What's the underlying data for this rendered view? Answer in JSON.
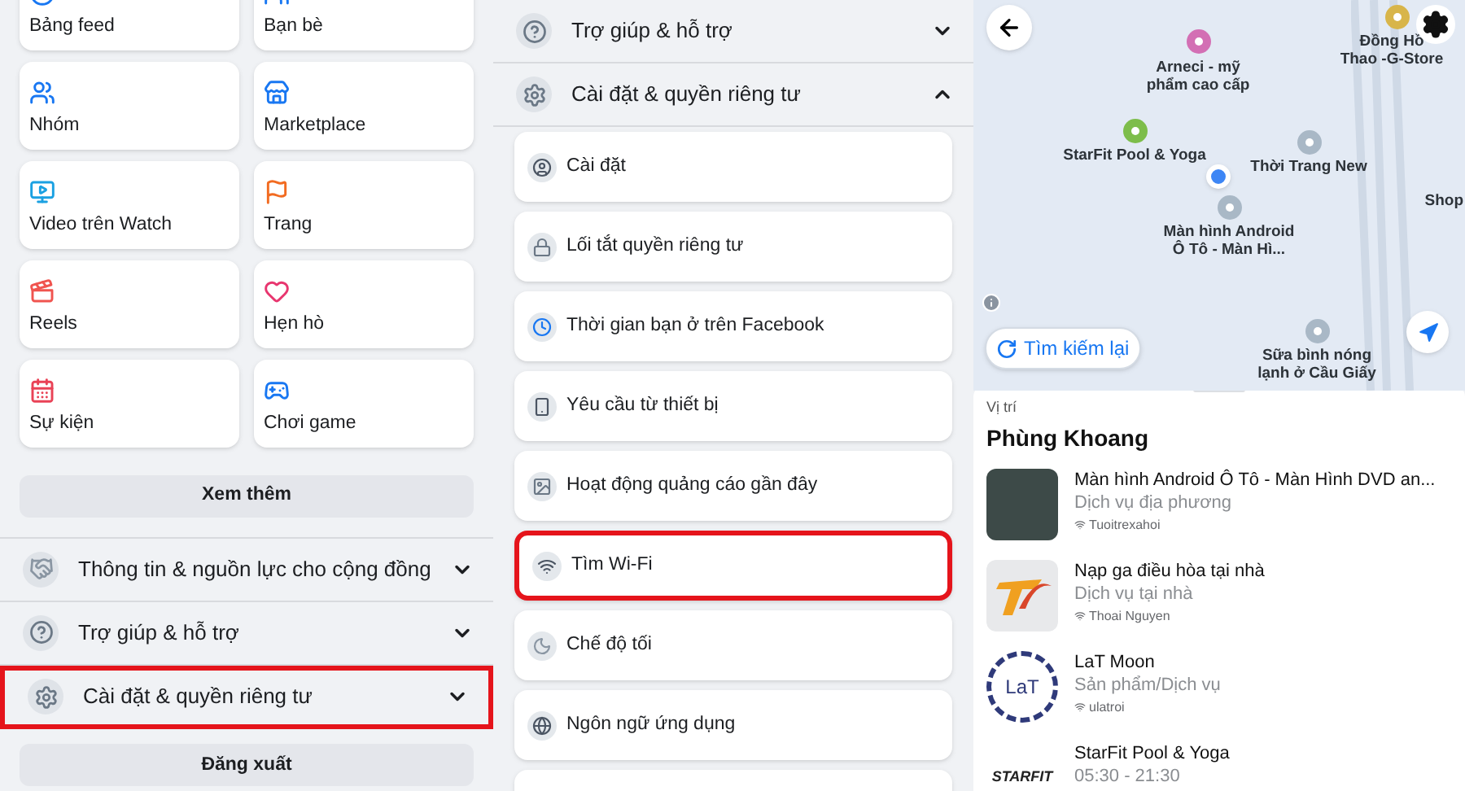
{
  "menu_panel": {
    "shortcuts": [
      {
        "label": "Bảng feed",
        "kind": "clock"
      },
      {
        "label": "Bạn bè",
        "kind": "friends"
      },
      {
        "label": "Nhóm",
        "kind": "groups"
      },
      {
        "label": "Marketplace",
        "kind": "store"
      },
      {
        "label": "Video trên Watch",
        "kind": "video"
      },
      {
        "label": "Trang",
        "kind": "flag"
      },
      {
        "label": "Reels",
        "kind": "reels"
      },
      {
        "label": "Hẹn hò",
        "kind": "heart"
      },
      {
        "label": "Sự kiện",
        "kind": "calendar"
      },
      {
        "label": "Chơi game",
        "kind": "gamepad"
      }
    ],
    "see_more": "Xem thêm",
    "sections": [
      {
        "label": "Thông tin & nguồn lực cho cộng đồng",
        "kind": "handshake",
        "expanded": false,
        "highlighted": false
      },
      {
        "label": "Trợ giúp & hỗ trợ",
        "kind": "help",
        "expanded": false,
        "highlighted": false
      },
      {
        "label": "Cài đặt & quyền riêng tư",
        "kind": "gear",
        "expanded": false,
        "highlighted": true
      }
    ],
    "logout": "Đăng xuất"
  },
  "settings_panel": {
    "sections": [
      {
        "label": "Trợ giúp & hỗ trợ",
        "kind": "help",
        "expanded": false
      },
      {
        "label": "Cài đặt & quyền riêng tư",
        "kind": "gear",
        "expanded": true
      }
    ],
    "items": [
      {
        "label": "Cài đặt",
        "kind": "person",
        "highlighted": false
      },
      {
        "label": "Lối tắt quyền riêng tư",
        "kind": "lock",
        "highlighted": false
      },
      {
        "label": "Thời gian bạn ở trên Facebook",
        "kind": "clock",
        "highlighted": false
      },
      {
        "label": "Yêu cầu từ thiết bị",
        "kind": "device",
        "highlighted": false
      },
      {
        "label": "Hoạt động quảng cáo gần đây",
        "kind": "image",
        "highlighted": false
      },
      {
        "label": "Tìm Wi-Fi",
        "kind": "wifi",
        "highlighted": true
      },
      {
        "label": "Chế độ tối",
        "kind": "moon",
        "highlighted": false
      },
      {
        "label": "Ngôn ngữ ứng dụng",
        "kind": "globe",
        "highlighted": false
      }
    ]
  },
  "map_panel": {
    "pins": [
      {
        "lines": [
          "Arneci - mỹ",
          "phẩm cao cấp"
        ],
        "color": "#d36fb4"
      },
      {
        "lines": [
          "StarFit Pool & Yoga"
        ],
        "color": "#7dbd4a"
      },
      {
        "lines": [
          "Thời Trang New"
        ],
        "color": "#a9b8c6"
      },
      {
        "lines": [
          "Màn hình Android",
          "Ô Tô - Màn Hì..."
        ],
        "color": "#a9b8c6"
      },
      {
        "lines": [
          "Đồng Hồ",
          "Thao -G-Store"
        ],
        "color": "#d8b54a"
      },
      {
        "lines": [
          "Shop"
        ]
      },
      {
        "lines": [
          "Sữa bình nóng",
          "lạnh ở Cầu Giấy"
        ],
        "color": "#a9b8c6"
      }
    ],
    "search_again": "Tìm kiếm lại",
    "sheet": {
      "caption": "Vị trí",
      "title": "Phùng Khoang",
      "places": [
        {
          "name": "Màn hình Android Ô Tô - Màn Hình DVD an...",
          "category": "Dịch vụ địa phương",
          "source": "Tuoitrexahoi",
          "kind": "photo"
        },
        {
          "name": "Nạp ga điều hòa tại nhà",
          "category": "Dịch vụ tại nhà",
          "source": "Thoai Nguyen",
          "kind": "ta"
        },
        {
          "name": "LaT Moon",
          "category": "Sản phẩm/Dịch vụ",
          "source": "ulatroi",
          "kind": "lat",
          "logo_text": "LaT"
        },
        {
          "name": "StarFit Pool & Yoga",
          "category": "05:30 - 21:30",
          "kind": "starfit",
          "logo_text": "STARFIT"
        }
      ]
    }
  }
}
